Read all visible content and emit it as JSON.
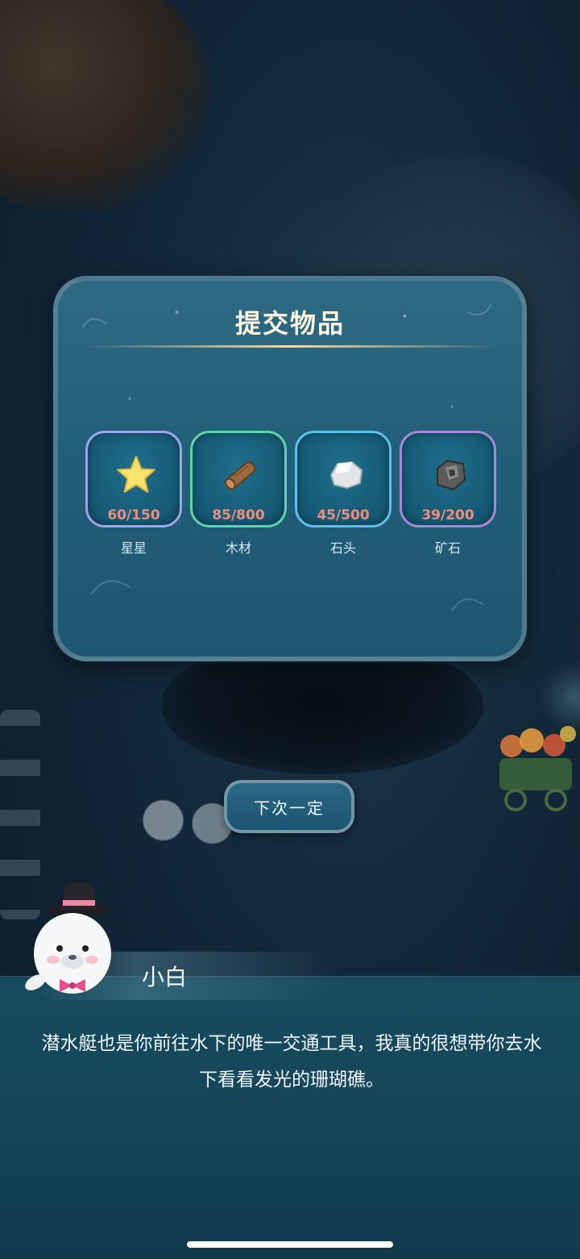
{
  "panel": {
    "title": "提交物品",
    "items": [
      {
        "name": "星星",
        "count": "60/150",
        "icon": "star-icon",
        "color": "#f5e06a"
      },
      {
        "name": "木材",
        "count": "85/800",
        "icon": "wood-log-icon",
        "color": "#9a6a3c"
      },
      {
        "name": "石头",
        "count": "45/500",
        "icon": "stone-icon",
        "color": "#d9dde0"
      },
      {
        "name": "矿石",
        "count": "39/200",
        "icon": "ore-icon",
        "color": "#5b5b5b"
      }
    ]
  },
  "button": {
    "label": "下次一定"
  },
  "dialog": {
    "speaker": "小白",
    "text": "潜水艇也是你前往水下的唯一交通工具，我真的很想带你去水下看看发光的珊瑚礁。"
  },
  "colors": {
    "count_text": "#f08c7a",
    "title_text": "#fff5de",
    "panel_bg": "#23607a"
  }
}
